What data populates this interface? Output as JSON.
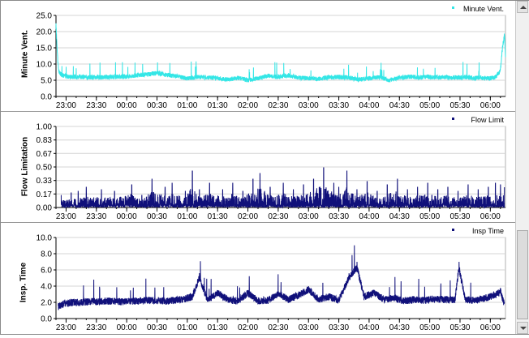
{
  "colors": {
    "minute_vent": "#33e6e6",
    "flow_limit": "#10107a",
    "insp_time": "#10107a",
    "grid": "#d4d4d4",
    "axis": "#000000"
  },
  "chart_data": [
    {
      "type": "line",
      "ylabel": "Minute Vent.",
      "legend": "Minute Vent.",
      "legend_position": "top-right",
      "grid": true,
      "ylim": [
        0,
        25
      ],
      "yticks": [
        "25.0",
        "20.0",
        "15.0",
        "10.0",
        "5.0",
        "0.0"
      ],
      "ytick_values": [
        25,
        20,
        15,
        10,
        5,
        0
      ],
      "xticks": [
        "23:00",
        "23:30",
        "00:00",
        "00:30",
        "01:00",
        "01:30",
        "02:00",
        "02:30",
        "03:00",
        "03:30",
        "04:00",
        "04:30",
        "05:00",
        "05:30",
        "06:00"
      ],
      "x_start": "22:50",
      "x_end": "06:15",
      "series": [
        {
          "name": "Minute Vent.",
          "x": [
            "22:50",
            "22:51",
            "22:52",
            "22:53",
            "22:55",
            "23:00",
            "23:15",
            "23:30",
            "23:45",
            "00:00",
            "00:10",
            "00:20",
            "00:30",
            "00:40",
            "00:50",
            "01:00",
            "01:10",
            "01:20",
            "01:30",
            "01:40",
            "01:50",
            "02:00",
            "02:10",
            "02:20",
            "02:30",
            "02:40",
            "02:50",
            "03:00",
            "03:10",
            "03:20",
            "03:30",
            "03:40",
            "03:50",
            "04:00",
            "04:10",
            "04:20",
            "04:30",
            "04:40",
            "04:50",
            "05:00",
            "05:10",
            "05:20",
            "05:30",
            "05:40",
            "05:50",
            "06:00",
            "06:05",
            "06:10",
            "06:12",
            "06:14",
            "06:15"
          ],
          "values": [
            22,
            16,
            10,
            7.5,
            6.8,
            6.2,
            6.0,
            5.9,
            6.0,
            6.1,
            6.5,
            6.8,
            7.2,
            6.6,
            6.2,
            5.6,
            6.0,
            5.9,
            5.7,
            5.2,
            5.8,
            5.0,
            5.6,
            6.4,
            6.0,
            6.5,
            5.8,
            5.6,
            5.4,
            5.9,
            6.0,
            5.8,
            5.2,
            5.6,
            5.9,
            5.0,
            5.8,
            6.1,
            5.9,
            6.0,
            5.9,
            5.8,
            5.9,
            5.8,
            5.7,
            5.6,
            5.9,
            8,
            15,
            19,
            12
          ]
        }
      ]
    },
    {
      "type": "line",
      "ylabel": "Flow Limitation",
      "legend": "Flow Limit",
      "legend_position": "top-right",
      "grid": true,
      "ylim": [
        0,
        1
      ],
      "yticks": [
        "1.00",
        "0.83",
        "0.67",
        "0.50",
        "0.33",
        "0.17",
        "0.00"
      ],
      "ytick_values": [
        1,
        0.833,
        0.667,
        0.5,
        0.333,
        0.167,
        0
      ],
      "xticks": [
        "23:00",
        "23:30",
        "00:00",
        "00:30",
        "01:00",
        "01:30",
        "02:00",
        "02:30",
        "03:00",
        "03:30",
        "04:00",
        "04:30",
        "05:00",
        "05:30",
        "06:00"
      ],
      "x_start": "22:50",
      "x_end": "06:15",
      "series": [
        {
          "name": "Flow Limit",
          "x": [
            "22:55",
            "23:05",
            "23:12",
            "23:20",
            "23:35",
            "23:48",
            "00:05",
            "00:15",
            "00:25",
            "00:38",
            "00:45",
            "00:58",
            "01:05",
            "01:12",
            "01:22",
            "01:35",
            "01:45",
            "01:55",
            "02:05",
            "02:12",
            "02:22",
            "02:35",
            "02:45",
            "02:55",
            "03:05",
            "03:15",
            "03:25",
            "03:30",
            "03:38",
            "03:48",
            "03:58",
            "04:08",
            "04:18",
            "04:28",
            "04:38",
            "04:48",
            "04:58",
            "05:08",
            "05:18",
            "05:28",
            "05:38",
            "05:48",
            "05:58",
            "06:05",
            "06:10",
            "06:14"
          ],
          "values": [
            0.15,
            0.18,
            0.2,
            0.25,
            0.22,
            0.2,
            0.28,
            0.15,
            0.35,
            0.25,
            0.3,
            0.2,
            0.45,
            0.22,
            0.3,
            0.22,
            0.3,
            0.2,
            0.35,
            0.42,
            0.25,
            0.3,
            0.22,
            0.28,
            0.35,
            0.49,
            0.3,
            0.25,
            0.45,
            0.22,
            0.32,
            0.2,
            0.28,
            0.35,
            0.22,
            0.25,
            0.3,
            0.22,
            0.25,
            0.2,
            0.28,
            0.22,
            0.25,
            0.3,
            0.28,
            0.25
          ]
        }
      ]
    },
    {
      "type": "line",
      "ylabel": "Insp. Time",
      "legend": "Insp Time",
      "legend_position": "top-right",
      "grid": true,
      "ylim": [
        0,
        10
      ],
      "yticks": [
        "10.0",
        "8.0",
        "6.0",
        "4.0",
        "2.0",
        "0.0"
      ],
      "ytick_values": [
        10,
        8,
        6,
        4,
        2,
        0
      ],
      "xticks": [
        "23:00",
        "23:30",
        "00:00",
        "00:30",
        "01:00",
        "01:30",
        "02:00",
        "02:30",
        "03:00",
        "03:30",
        "04:00",
        "04:30",
        "05:00",
        "05:30",
        "06:00"
      ],
      "x_start": "22:50",
      "x_end": "06:15",
      "series": [
        {
          "name": "Insp Time",
          "x": [
            "22:52",
            "22:58",
            "23:10",
            "23:25",
            "23:40",
            "23:55",
            "00:10",
            "00:25",
            "00:40",
            "00:55",
            "01:05",
            "01:12",
            "01:20",
            "01:30",
            "01:40",
            "01:50",
            "02:00",
            "02:10",
            "02:20",
            "02:30",
            "02:40",
            "02:50",
            "03:00",
            "03:10",
            "03:20",
            "03:30",
            "03:40",
            "03:48",
            "03:55",
            "04:05",
            "04:15",
            "04:25",
            "04:35",
            "04:45",
            "04:55",
            "05:05",
            "05:15",
            "05:25",
            "05:29",
            "05:35",
            "05:45",
            "05:55",
            "06:05",
            "06:10",
            "06:14"
          ],
          "values": [
            1.6,
            2.1,
            2.2,
            2.3,
            2.4,
            2.3,
            2.4,
            2.5,
            2.4,
            2.6,
            3.0,
            5.6,
            2.5,
            3.5,
            2.6,
            2.4,
            3.5,
            2.4,
            2.5,
            3.4,
            2.6,
            3.2,
            4.0,
            2.6,
            3.0,
            2.5,
            5.6,
            7.0,
            3.0,
            3.5,
            2.6,
            2.8,
            2.4,
            2.6,
            2.5,
            2.7,
            2.6,
            2.6,
            7.0,
            2.6,
            2.5,
            2.8,
            3.2,
            3.8,
            1.8
          ]
        }
      ]
    }
  ]
}
